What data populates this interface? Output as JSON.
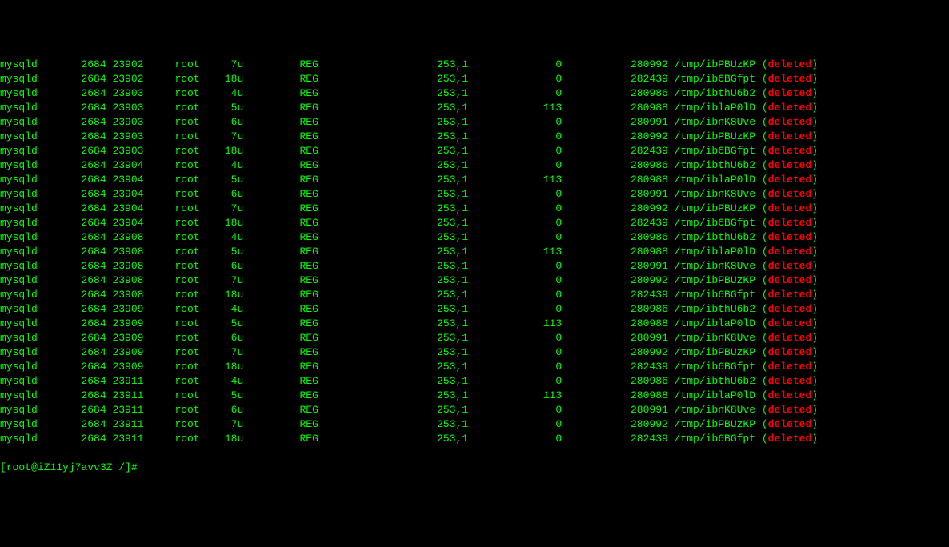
{
  "rows": [
    {
      "cmd": "mysqld",
      "pid": "2684",
      "tid": "23902",
      "user": "root",
      "fd": "7u",
      "type": "REG",
      "dev": "253,1",
      "size": "0",
      "node": "280992",
      "name": "/tmp/ibPBUzKP",
      "del": "deleted"
    },
    {
      "cmd": "mysqld",
      "pid": "2684",
      "tid": "23902",
      "user": "root",
      "fd": "18u",
      "type": "REG",
      "dev": "253,1",
      "size": "0",
      "node": "282439",
      "name": "/tmp/ib6BGfpt",
      "del": "deleted"
    },
    {
      "cmd": "mysqld",
      "pid": "2684",
      "tid": "23903",
      "user": "root",
      "fd": "4u",
      "type": "REG",
      "dev": "253,1",
      "size": "0",
      "node": "280986",
      "name": "/tmp/ibthU6b2",
      "del": "deleted"
    },
    {
      "cmd": "mysqld",
      "pid": "2684",
      "tid": "23903",
      "user": "root",
      "fd": "5u",
      "type": "REG",
      "dev": "253,1",
      "size": "113",
      "node": "280988",
      "name": "/tmp/iblaP0lD",
      "del": "deleted"
    },
    {
      "cmd": "mysqld",
      "pid": "2684",
      "tid": "23903",
      "user": "root",
      "fd": "6u",
      "type": "REG",
      "dev": "253,1",
      "size": "0",
      "node": "280991",
      "name": "/tmp/ibnK8Uve",
      "del": "deleted"
    },
    {
      "cmd": "mysqld",
      "pid": "2684",
      "tid": "23903",
      "user": "root",
      "fd": "7u",
      "type": "REG",
      "dev": "253,1",
      "size": "0",
      "node": "280992",
      "name": "/tmp/ibPBUzKP",
      "del": "deleted"
    },
    {
      "cmd": "mysqld",
      "pid": "2684",
      "tid": "23903",
      "user": "root",
      "fd": "18u",
      "type": "REG",
      "dev": "253,1",
      "size": "0",
      "node": "282439",
      "name": "/tmp/ib6BGfpt",
      "del": "deleted"
    },
    {
      "cmd": "mysqld",
      "pid": "2684",
      "tid": "23904",
      "user": "root",
      "fd": "4u",
      "type": "REG",
      "dev": "253,1",
      "size": "0",
      "node": "280986",
      "name": "/tmp/ibthU6b2",
      "del": "deleted"
    },
    {
      "cmd": "mysqld",
      "pid": "2684",
      "tid": "23904",
      "user": "root",
      "fd": "5u",
      "type": "REG",
      "dev": "253,1",
      "size": "113",
      "node": "280988",
      "name": "/tmp/iblaP0lD",
      "del": "deleted"
    },
    {
      "cmd": "mysqld",
      "pid": "2684",
      "tid": "23904",
      "user": "root",
      "fd": "6u",
      "type": "REG",
      "dev": "253,1",
      "size": "0",
      "node": "280991",
      "name": "/tmp/ibnK8Uve",
      "del": "deleted"
    },
    {
      "cmd": "mysqld",
      "pid": "2684",
      "tid": "23904",
      "user": "root",
      "fd": "7u",
      "type": "REG",
      "dev": "253,1",
      "size": "0",
      "node": "280992",
      "name": "/tmp/ibPBUzKP",
      "del": "deleted"
    },
    {
      "cmd": "mysqld",
      "pid": "2684",
      "tid": "23904",
      "user": "root",
      "fd": "18u",
      "type": "REG",
      "dev": "253,1",
      "size": "0",
      "node": "282439",
      "name": "/tmp/ib6BGfpt",
      "del": "deleted"
    },
    {
      "cmd": "mysqld",
      "pid": "2684",
      "tid": "23908",
      "user": "root",
      "fd": "4u",
      "type": "REG",
      "dev": "253,1",
      "size": "0",
      "node": "280986",
      "name": "/tmp/ibthU6b2",
      "del": "deleted"
    },
    {
      "cmd": "mysqld",
      "pid": "2684",
      "tid": "23908",
      "user": "root",
      "fd": "5u",
      "type": "REG",
      "dev": "253,1",
      "size": "113",
      "node": "280988",
      "name": "/tmp/iblaP0lD",
      "del": "deleted"
    },
    {
      "cmd": "mysqld",
      "pid": "2684",
      "tid": "23908",
      "user": "root",
      "fd": "6u",
      "type": "REG",
      "dev": "253,1",
      "size": "0",
      "node": "280991",
      "name": "/tmp/ibnK8Uve",
      "del": "deleted"
    },
    {
      "cmd": "mysqld",
      "pid": "2684",
      "tid": "23908",
      "user": "root",
      "fd": "7u",
      "type": "REG",
      "dev": "253,1",
      "size": "0",
      "node": "280992",
      "name": "/tmp/ibPBUzKP",
      "del": "deleted"
    },
    {
      "cmd": "mysqld",
      "pid": "2684",
      "tid": "23908",
      "user": "root",
      "fd": "18u",
      "type": "REG",
      "dev": "253,1",
      "size": "0",
      "node": "282439",
      "name": "/tmp/ib6BGfpt",
      "del": "deleted"
    },
    {
      "cmd": "mysqld",
      "pid": "2684",
      "tid": "23909",
      "user": "root",
      "fd": "4u",
      "type": "REG",
      "dev": "253,1",
      "size": "0",
      "node": "280986",
      "name": "/tmp/ibthU6b2",
      "del": "deleted"
    },
    {
      "cmd": "mysqld",
      "pid": "2684",
      "tid": "23909",
      "user": "root",
      "fd": "5u",
      "type": "REG",
      "dev": "253,1",
      "size": "113",
      "node": "280988",
      "name": "/tmp/iblaP0lD",
      "del": "deleted"
    },
    {
      "cmd": "mysqld",
      "pid": "2684",
      "tid": "23909",
      "user": "root",
      "fd": "6u",
      "type": "REG",
      "dev": "253,1",
      "size": "0",
      "node": "280991",
      "name": "/tmp/ibnK8Uve",
      "del": "deleted"
    },
    {
      "cmd": "mysqld",
      "pid": "2684",
      "tid": "23909",
      "user": "root",
      "fd": "7u",
      "type": "REG",
      "dev": "253,1",
      "size": "0",
      "node": "280992",
      "name": "/tmp/ibPBUzKP",
      "del": "deleted"
    },
    {
      "cmd": "mysqld",
      "pid": "2684",
      "tid": "23909",
      "user": "root",
      "fd": "18u",
      "type": "REG",
      "dev": "253,1",
      "size": "0",
      "node": "282439",
      "name": "/tmp/ib6BGfpt",
      "del": "deleted"
    },
    {
      "cmd": "mysqld",
      "pid": "2684",
      "tid": "23911",
      "user": "root",
      "fd": "4u",
      "type": "REG",
      "dev": "253,1",
      "size": "0",
      "node": "280986",
      "name": "/tmp/ibthU6b2",
      "del": "deleted"
    },
    {
      "cmd": "mysqld",
      "pid": "2684",
      "tid": "23911",
      "user": "root",
      "fd": "5u",
      "type": "REG",
      "dev": "253,1",
      "size": "113",
      "node": "280988",
      "name": "/tmp/iblaP0lD",
      "del": "deleted"
    },
    {
      "cmd": "mysqld",
      "pid": "2684",
      "tid": "23911",
      "user": "root",
      "fd": "6u",
      "type": "REG",
      "dev": "253,1",
      "size": "0",
      "node": "280991",
      "name": "/tmp/ibnK8Uve",
      "del": "deleted"
    },
    {
      "cmd": "mysqld",
      "pid": "2684",
      "tid": "23911",
      "user": "root",
      "fd": "7u",
      "type": "REG",
      "dev": "253,1",
      "size": "0",
      "node": "280992",
      "name": "/tmp/ibPBUzKP",
      "del": "deleted"
    },
    {
      "cmd": "mysqld",
      "pid": "2684",
      "tid": "23911",
      "user": "root",
      "fd": "18u",
      "type": "REG",
      "dev": "253,1",
      "size": "0",
      "node": "282439",
      "name": "/tmp/ib6BGfpt",
      "del": "deleted"
    }
  ],
  "prompt": {
    "open_bracket": "[",
    "user_host": "root@iZ11yj7avv3Z",
    "path": " /",
    "close_bracket": "]",
    "symbol": "# "
  }
}
